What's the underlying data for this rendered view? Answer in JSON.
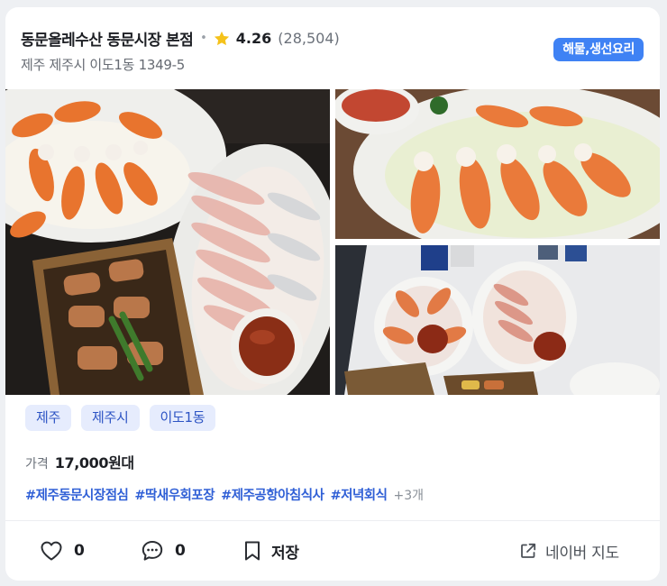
{
  "listing": {
    "name": "동문올레수산 동문시장 본점",
    "separator": "•",
    "rating": "4.26",
    "review_count": "(28,504)",
    "address": "제주 제주시 이도1동 1349-5",
    "category": "해물,생선요리"
  },
  "tags": [
    "제주",
    "제주시",
    "이도1동"
  ],
  "price": {
    "label": "가격",
    "value": "17,000원대"
  },
  "hashtags": [
    "#제주동문시장점심",
    "#딱새우회포장",
    "#제주공항아침식사",
    "#저녁회식"
  ],
  "hashtags_more": "+3개",
  "actions": {
    "like_count": "0",
    "comment_count": "0",
    "save_label": "저장",
    "map_label": "네이버 지도"
  },
  "colors": {
    "accent": "#3f82f4",
    "tag_bg": "#e6ecfd",
    "hashtag": "#2f5fd6",
    "star": "#f5c21b"
  }
}
